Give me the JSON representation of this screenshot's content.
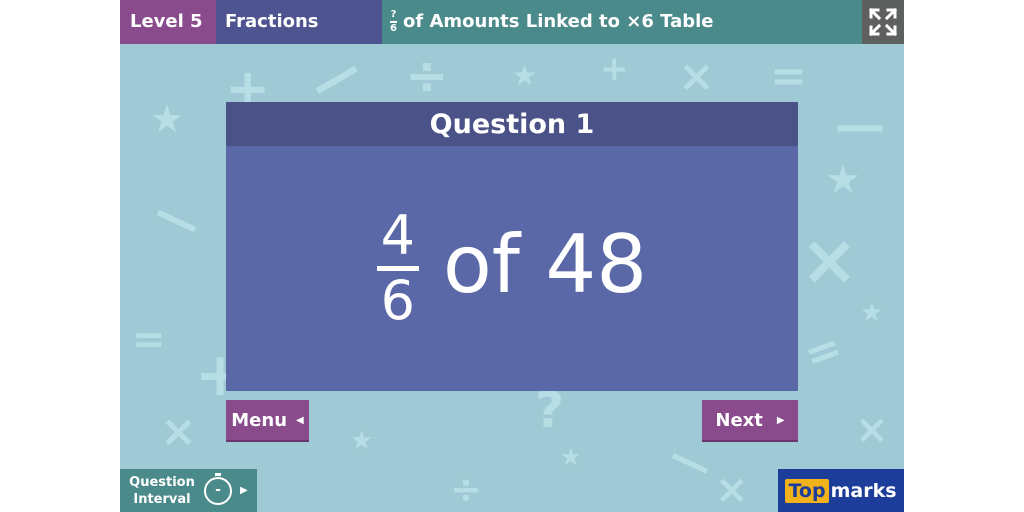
{
  "topbar": {
    "level": "Level 5",
    "topic": "Fractions",
    "title_fraction": {
      "numerator": "?",
      "denominator": "6"
    },
    "title": "of Amounts Linked to ×6 Table"
  },
  "question": {
    "heading": "Question 1",
    "numerator": "4",
    "denominator": "6",
    "text": "of 48"
  },
  "buttons": {
    "menu": "Menu",
    "next": "Next"
  },
  "question_interval": {
    "label_line1": "Question",
    "label_line2": "Interval",
    "value": "-"
  },
  "logo": {
    "part1": "Top",
    "part2": "marks"
  },
  "icons": {
    "fullscreen": "fullscreen-icon",
    "timer": "stopwatch-icon"
  },
  "colors": {
    "background": "#9fcad5",
    "card": "#5b68a8",
    "card_header": "#4a5288",
    "button": "#8a4b8d",
    "teal": "#4b8a8a"
  }
}
